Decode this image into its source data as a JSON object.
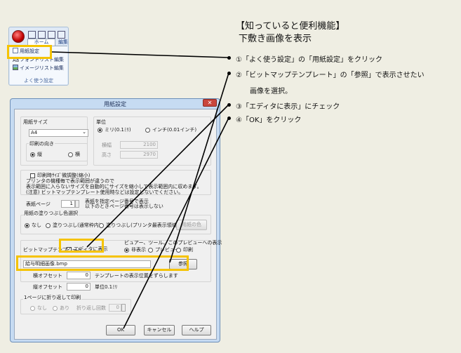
{
  "ribbon": {
    "tab_home": "ホーム",
    "tab_edit": "編集",
    "items": [
      "用紙設定",
      "フォントリスト編集",
      "イメージリスト編集"
    ],
    "group_label": "よく使う設定"
  },
  "dialog": {
    "title": "用紙設定",
    "close_glyph": "✕",
    "paper_size": {
      "label": "用紙サイズ",
      "value": "A4",
      "chevron": "⌄"
    },
    "orientation": {
      "label": "印刷の向き",
      "options": [
        "縦",
        "横"
      ],
      "selected": "縦"
    },
    "unit": {
      "label": "単位",
      "options": [
        "ミリ(0.1ﾐﾘ)",
        "インチ(0.01インチ)"
      ],
      "selected": "ミリ(0.1ﾐﾘ)",
      "width_label": "横幅",
      "width_value": "2100",
      "height_label": "高さ",
      "height_value": "2970"
    },
    "auto_size": {
      "label": "印刷時ｻｲｽﾞ微調整(縮小)",
      "lines": [
        "プリンタの機種毎で表示範囲が違うので",
        "表示範囲に入らないサイズを自動的にサイズを縮小して表示範囲内に収めます。",
        "(注意) ビットマップテンプレート使用時などは設定しないでください。"
      ]
    },
    "display_page": {
      "label": "表紙ページ",
      "value": "1",
      "notes": [
        "表紙を指定ページ番号で表示",
        "以下のときページ番号は表示しない"
      ]
    },
    "paper_color": {
      "label": "用紙の塗りつぶし色選択",
      "options": [
        "なし",
        "塗りつぶし(通常枠内)",
        "塗りつぶし(プリンタ最表示領域)"
      ],
      "selected": "なし",
      "color_button": "用紙の色"
    },
    "bitmap": {
      "label": "ビットマップテンプレート",
      "editor_check_label": "エディタに表示",
      "editor_checked": true,
      "viewer_label": "ビュアー、ツール、このプレビューへの表示",
      "viewer_options": [
        "非表示",
        "プレビュー",
        "印刷"
      ],
      "viewer_selected": "非表示",
      "file_value": "給与明細画像.bmp",
      "browse_button": "参照"
    },
    "offset": {
      "x_label": "横オフセット",
      "x_value": "0",
      "y_label": "縦オフセット",
      "y_value": "0",
      "note": "テンプレートの表示位置をずらします",
      "unit": "単位0.1ﾐﾘ"
    },
    "fold": {
      "label": "1ページに折り返して印刷",
      "options": [
        "なし",
        "あり"
      ],
      "count_label": "折り返し回数",
      "count_value": "0"
    },
    "buttons": {
      "ok": "OK",
      "cancel": "キャンセル",
      "help": "ヘルプ"
    }
  },
  "instructions": {
    "title_1": "【知っていると便利機能】",
    "title_2": "下敷き画像を表示",
    "step1": "①「よく使う設定」の「用紙設定」をクリック",
    "step2_a": "②「ビットマップテンプレート」の「参照」で表示させたい",
    "step2_b": "画像を選択。",
    "step3": "③「エディタに表示」にチェック",
    "step4": "④「OK」をクリック"
  },
  "colors": {
    "highlight": "#f5c300",
    "background": "#efeee3",
    "dialog_frame": "#c6dbf2"
  }
}
